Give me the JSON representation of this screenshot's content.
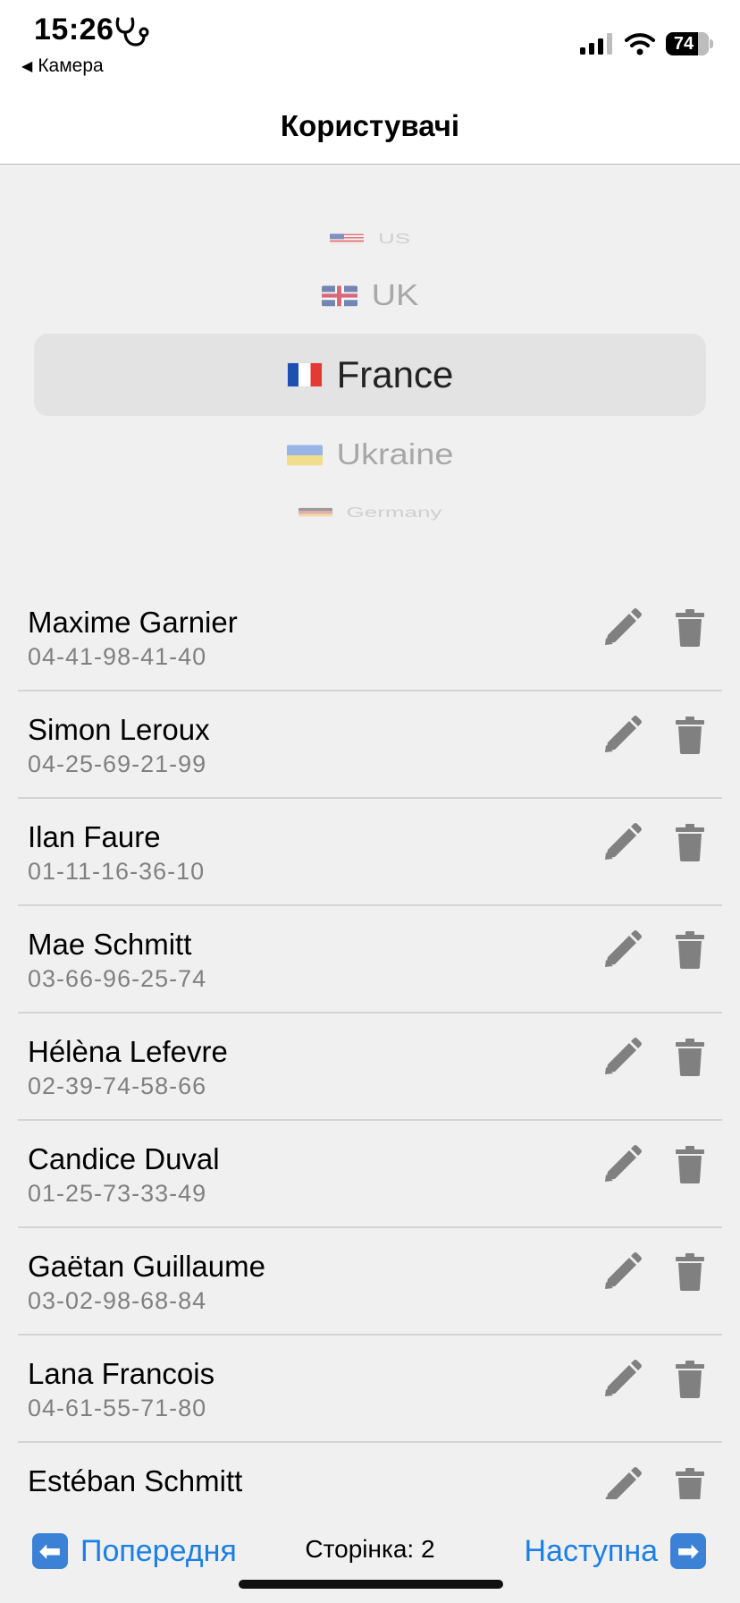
{
  "status": {
    "time": "15:26",
    "back_app": "Камера",
    "battery": "74"
  },
  "nav": {
    "title": "Користувачі"
  },
  "picker": {
    "selected": "France",
    "options": [
      {
        "label": "US",
        "icon": "flag-us-icon"
      },
      {
        "label": "UK",
        "icon": "flag-uk-icon"
      },
      {
        "label": "France",
        "icon": "flag-france-icon"
      },
      {
        "label": "Ukraine",
        "icon": "flag-ukraine-icon"
      },
      {
        "label": "Germany",
        "icon": "flag-germany-icon"
      }
    ]
  },
  "users": [
    {
      "name": "Maxime Garnier",
      "phone": "04-41-98-41-40"
    },
    {
      "name": "Simon Leroux",
      "phone": "04-25-69-21-99"
    },
    {
      "name": "Ilan Faure",
      "phone": "01-11-16-36-10"
    },
    {
      "name": "Mae Schmitt",
      "phone": "03-66-96-25-74"
    },
    {
      "name": "Hélèna Lefevre",
      "phone": "02-39-74-58-66"
    },
    {
      "name": "Candice Duval",
      "phone": "01-25-73-33-49"
    },
    {
      "name": "Gaëtan Guillaume",
      "phone": "03-02-98-68-84"
    },
    {
      "name": "Lana Francois",
      "phone": "04-61-55-71-80"
    },
    {
      "name": "Estéban Schmitt",
      "phone": ""
    }
  ],
  "pagination": {
    "prev_label": "Попередня",
    "next_label": "Наступна",
    "page_label": "Сторінка: 2"
  },
  "colors": {
    "accent": "#1a7fe6",
    "icon_gray": "#808080"
  }
}
